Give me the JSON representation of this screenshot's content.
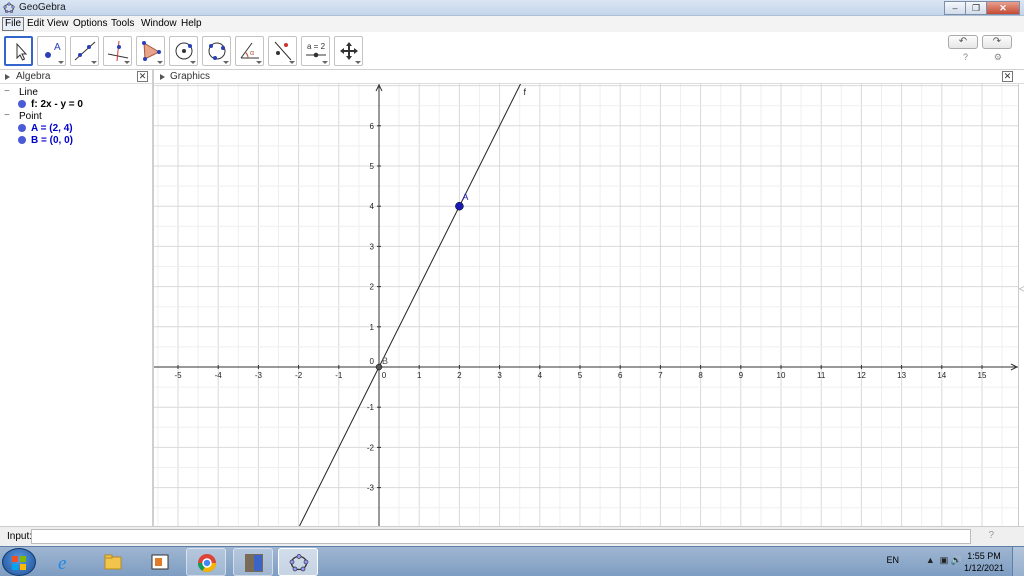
{
  "window": {
    "title": "GeoGebra"
  },
  "menu": [
    "File",
    "Edit",
    "View",
    "Options",
    "Tools",
    "Window",
    "Help"
  ],
  "toolbar": {
    "tools": [
      {
        "name": "move-tool-icon",
        "selected": true
      },
      {
        "name": "point-tool-icon"
      },
      {
        "name": "line-tool-icon"
      },
      {
        "name": "perpendicular-line-tool-icon"
      },
      {
        "name": "polygon-tool-icon"
      },
      {
        "name": "circle-center-point-tool-icon"
      },
      {
        "name": "circle-three-points-tool-icon"
      },
      {
        "name": "angle-tool-icon"
      },
      {
        "name": "reflect-tool-icon"
      },
      {
        "name": "slider-tool-icon",
        "label": "a = 2"
      },
      {
        "name": "move-graphics-view-tool-icon"
      }
    ]
  },
  "algebra": {
    "title": "Algebra",
    "groups": [
      {
        "label": "Line",
        "items": [
          {
            "text": "f: 2x - y = 0"
          }
        ]
      },
      {
        "label": "Point",
        "items": [
          {
            "text": "A = (2, 4)"
          },
          {
            "text": "B = (0, 0)"
          }
        ]
      }
    ]
  },
  "graphics": {
    "title": "Graphics",
    "x_min": -5,
    "x_max": 15,
    "y_min": -3,
    "y_max": 6,
    "x_tick_labels": [
      "-5",
      "-4",
      "-3",
      "-2",
      "-1",
      "0",
      "1",
      "2",
      "3",
      "4",
      "5",
      "6",
      "7",
      "8",
      "9",
      "10",
      "11",
      "12",
      "13",
      "14",
      "15"
    ],
    "y_tick_labels": [
      "-3",
      "-2",
      "-1",
      "1",
      "2",
      "3",
      "4",
      "5",
      "6"
    ],
    "origin_label": "0",
    "line": {
      "name": "f",
      "slope": 2,
      "intercept": 0
    },
    "points": [
      {
        "name": "A",
        "x": 2,
        "y": 4,
        "color": "#1a1ab3"
      },
      {
        "name": "B",
        "x": 0,
        "y": 0,
        "color": "#555555"
      }
    ]
  },
  "input_bar": {
    "label": "Input:",
    "value": ""
  },
  "tray": {
    "language": "EN",
    "time": "1:55 PM",
    "date": "1/12/2021"
  },
  "taskbar_apps": [
    "internet-explorer-icon",
    "file-explorer-icon",
    "media-player-icon",
    "chrome-icon",
    "photo-app-icon",
    "geogebra-icon"
  ]
}
